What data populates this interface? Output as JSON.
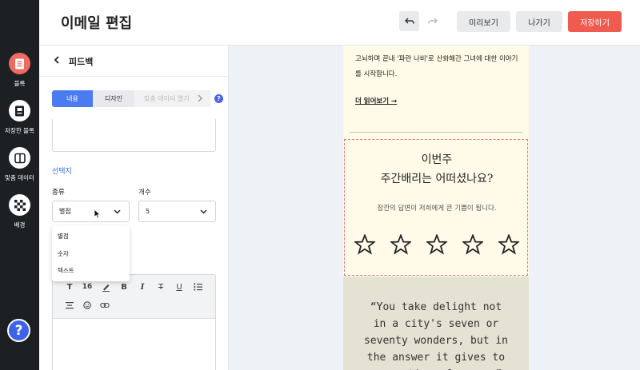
{
  "header": {
    "title": "이메일 편집",
    "preview_label": "미리보기",
    "exit_label": "나가기",
    "save_label": "저장하기",
    "accent_color": "#ef5b4f"
  },
  "rail": {
    "items": [
      {
        "label": "블록",
        "icon": "block-list-icon",
        "active": true
      },
      {
        "label": "저장한 블록",
        "icon": "saved-blocks-icon",
        "active": false
      },
      {
        "label": "맞춤 데이터",
        "icon": "custom-data-icon",
        "active": false
      },
      {
        "label": "배경",
        "icon": "checkerboard-icon",
        "active": false
      }
    ],
    "help_label": "?"
  },
  "panel": {
    "title": "피드백",
    "tabs": [
      "내용",
      "디자인",
      "맞춤 데이터 열기"
    ],
    "section_label": "선택지",
    "type_label": "종류",
    "count_label": "개수",
    "type_value": "별점",
    "count_value": "5",
    "type_options": [
      "별점",
      "숫자",
      "텍스트"
    ],
    "toolbar_size": "16"
  },
  "email": {
    "body_text": "고뇌하며 끝내 '파란 나비'로 산화해간 그녀에 대한 이야기를 시작합니다.",
    "read_more": "더 읽어보기 →",
    "feedback_title_line1": "이번주",
    "feedback_title_line2": "주간배리는 어떠셨나요?",
    "feedback_subtitle": "잠깐의 답변이 저희에게 큰 기쁨이 됩니다.",
    "star_count": 5,
    "quote": "“You take delight not\nin a city's seven or\nseventy wonders, but in\nthe answer it gives to\na question of yours.”"
  }
}
